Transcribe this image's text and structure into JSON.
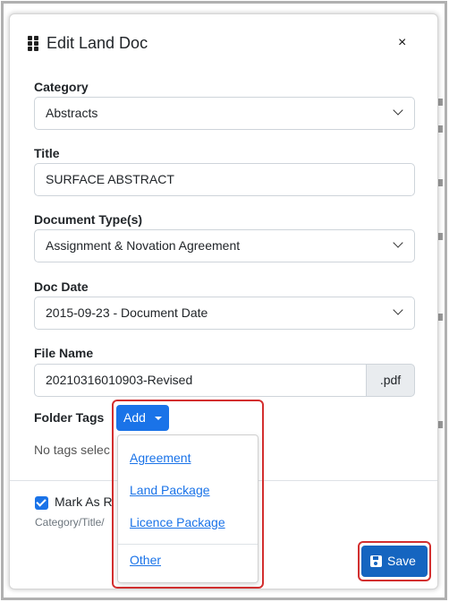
{
  "modal": {
    "title": "Edit Land Doc",
    "close": "×"
  },
  "fields": {
    "category": {
      "label": "Category",
      "value": "Abstracts"
    },
    "title": {
      "label": "Title",
      "value": "SURFACE ABSTRACT"
    },
    "document_type": {
      "label": "Document Type(s)",
      "value": "Assignment & Novation Agreement"
    },
    "doc_date": {
      "label": "Doc Date",
      "value": "2015-09-23 - Document Date"
    },
    "file_name": {
      "label": "File Name",
      "value": "20210316010903-Revised",
      "extension": ".pdf"
    }
  },
  "folder_tags": {
    "label": "Folder Tags",
    "add_label": "Add",
    "empty_text": "No tags selec",
    "menu": [
      "Agreement",
      "Land Package",
      "Licence Package",
      "Other"
    ]
  },
  "mark_as": {
    "label": "Mark As R",
    "checked": true,
    "sublabel": "Category/Title/"
  },
  "save_label": "Save",
  "colors": {
    "primary": "#1a73e8",
    "save": "#1565c0",
    "highlight": "#d32f2f"
  }
}
